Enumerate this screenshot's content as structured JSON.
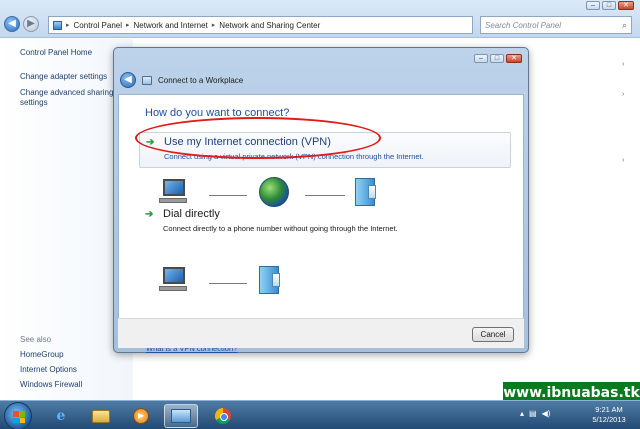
{
  "explorer": {
    "address_crumbs": [
      "Control Panel",
      "Network and Internet",
      "Network and Sharing Center"
    ],
    "search_placeholder": "Search Control Panel",
    "caption_buttons": {
      "minimize": "–",
      "maximize": "□",
      "close": "✕"
    }
  },
  "sidebar": {
    "home": "Control Panel Home",
    "links": [
      "Change adapter settings",
      "Change advanced sharing",
      "settings"
    ],
    "see_also_label": "See also",
    "see_also": [
      "HomeGroup",
      "Internet Options",
      "Windows Firewall"
    ]
  },
  "dialog": {
    "title": "Connect to a Workplace",
    "question": "How do you want to connect?",
    "options": [
      {
        "title": "Use my Internet connection (VPN)",
        "description": "Connect using a virtual private network (VPN) connection through the Internet."
      },
      {
        "title": "Dial directly",
        "description": "Connect directly to a phone number without going through the Internet."
      }
    ],
    "help_link": "What is a VPN connection?",
    "cancel_label": "Cancel",
    "arrow_glyph": "➔"
  },
  "taskbar": {
    "clock_time": "9:21 AM",
    "clock_date": "5/12/2013"
  },
  "watermark": "www.ibnuabas.tk",
  "colors": {
    "highlight_ellipse": "#e01b1b",
    "watermark_bg": "#0a7a1e",
    "link_blue": "#1f4fa0"
  }
}
